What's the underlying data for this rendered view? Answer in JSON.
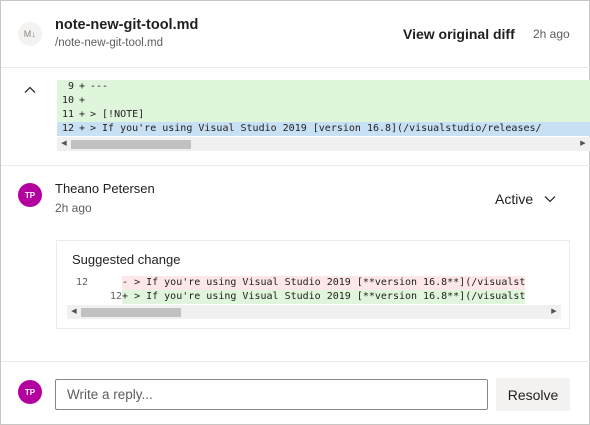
{
  "file": {
    "avatar_initials": "M↓",
    "name": "note-new-git-tool.md",
    "path": "/note-new-git-tool.md",
    "view_diff_label": "View original diff",
    "time": "2h ago"
  },
  "diff": {
    "lines": [
      {
        "num": "9",
        "mark": "+",
        "text": "---"
      },
      {
        "num": "10",
        "mark": "+",
        "text": ""
      },
      {
        "num": "11",
        "mark": "+",
        "text": "> [!NOTE]"
      },
      {
        "num": "12",
        "mark": "+",
        "text": "> If you're using Visual Studio 2019 [version 16.8](/visualstudio/releases/"
      }
    ],
    "colors": {
      "added": "#dff6dd",
      "selected": "#c7e0f4"
    }
  },
  "comment": {
    "initials": "TP",
    "author": "Theano Petersen",
    "time": "2h ago",
    "status": "Active",
    "avatar_color": "#b4009e"
  },
  "suggestion": {
    "title": "Suggested change",
    "old_line": {
      "num": "12",
      "mark": "-",
      "text": "> If you're using Visual Studio 2019 [**version 16.8**](/visualst"
    },
    "new_line": {
      "num": "12",
      "mark": "+",
      "text": "> If you're using Visual Studio 2019 [**version 16.8**](/visualst"
    },
    "colors": {
      "deleted": "#fde7e9",
      "added": "#dff6dd"
    }
  },
  "reply": {
    "initials": "TP",
    "placeholder": "Write a reply...",
    "resolve_label": "Resolve"
  },
  "icons": {
    "collapse": "chevron-up-icon",
    "status": "chevron-down-icon",
    "scroll_left": "scroll-left-arrow-icon",
    "scroll_right": "scroll-right-arrow-icon"
  }
}
